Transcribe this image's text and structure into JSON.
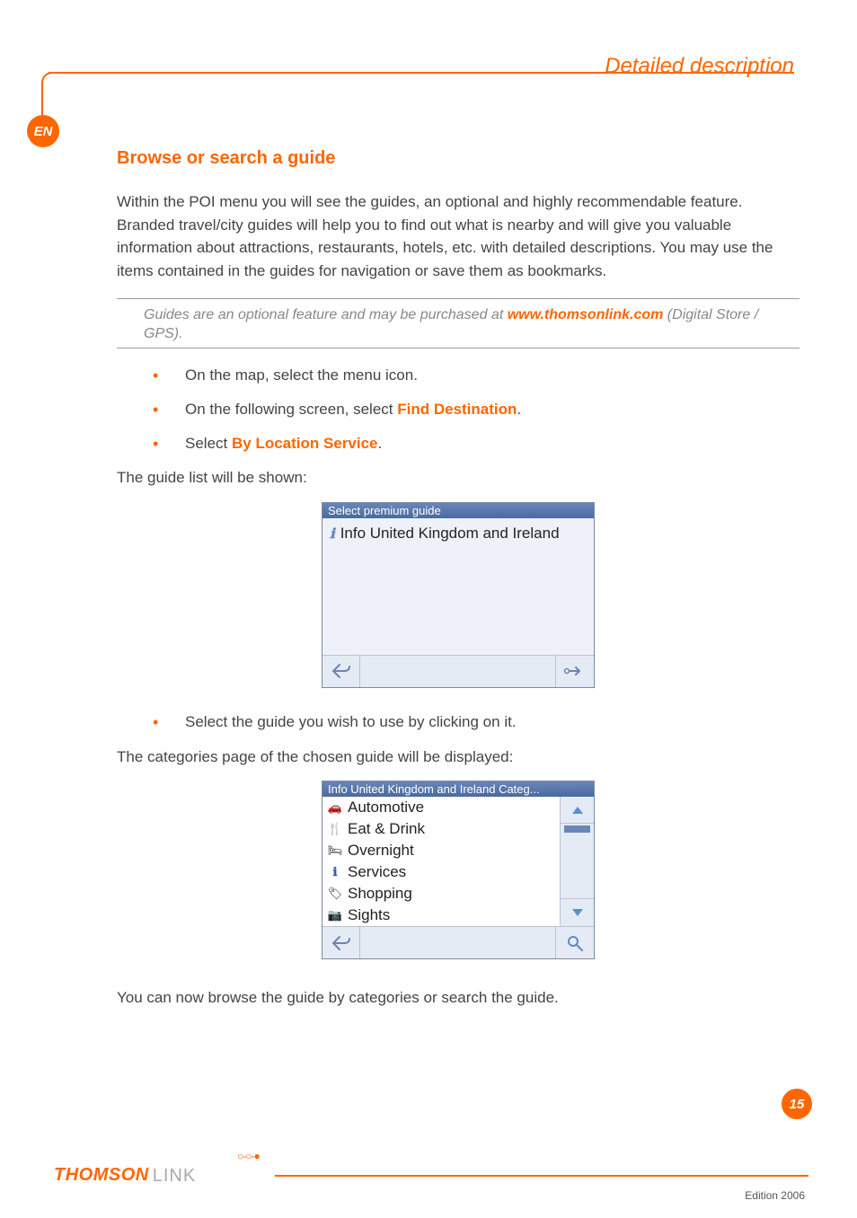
{
  "header": {
    "title": "Detailed description"
  },
  "lang_badge": "EN",
  "section_title": "Browse or search a guide",
  "intro": "Within the POI menu you will see the guides, an optional and highly recommendable feature. Branded travel/city guides will help you to find out what is nearby and will give you valuable information about attractions, restaurants, hotels, etc. with detailed descriptions. You may use the items contained in the guides for navigation or save them as bookmarks.",
  "note": {
    "prefix": "Guides are an optional feature and may be purchased at ",
    "link": "www.thomsonlink.com",
    "suffix": " (Digital Store / GPS)."
  },
  "steps_a": {
    "s1": "On the map, select the menu icon.",
    "s2_pre": "On the following screen, select ",
    "s2_bold": "Find Destination",
    "s2_post": ".",
    "s3_pre": "Select ",
    "s3_bold": "By Location Service",
    "s3_post": "."
  },
  "para_guide_list": "The guide list will be shown:",
  "shot1": {
    "title": "Select premium guide",
    "item": "Info United Kingdom and Ireland"
  },
  "steps_b": {
    "s1": "Select the guide you wish to use by clicking on it."
  },
  "para_categories": "The categories page of the chosen guide will be displayed:",
  "shot2": {
    "title": "Info United Kingdom and Ireland Categ...",
    "cats": [
      "Automotive",
      "Eat & Drink",
      "Overnight",
      "Services",
      "Shopping",
      "Sights"
    ]
  },
  "para_browse": "You can now browse the guide by categories or search the guide.",
  "footer": {
    "brand1": "THOMSON",
    "brand2": "LINK",
    "edition": "Edition 2006"
  },
  "page_number": "15"
}
